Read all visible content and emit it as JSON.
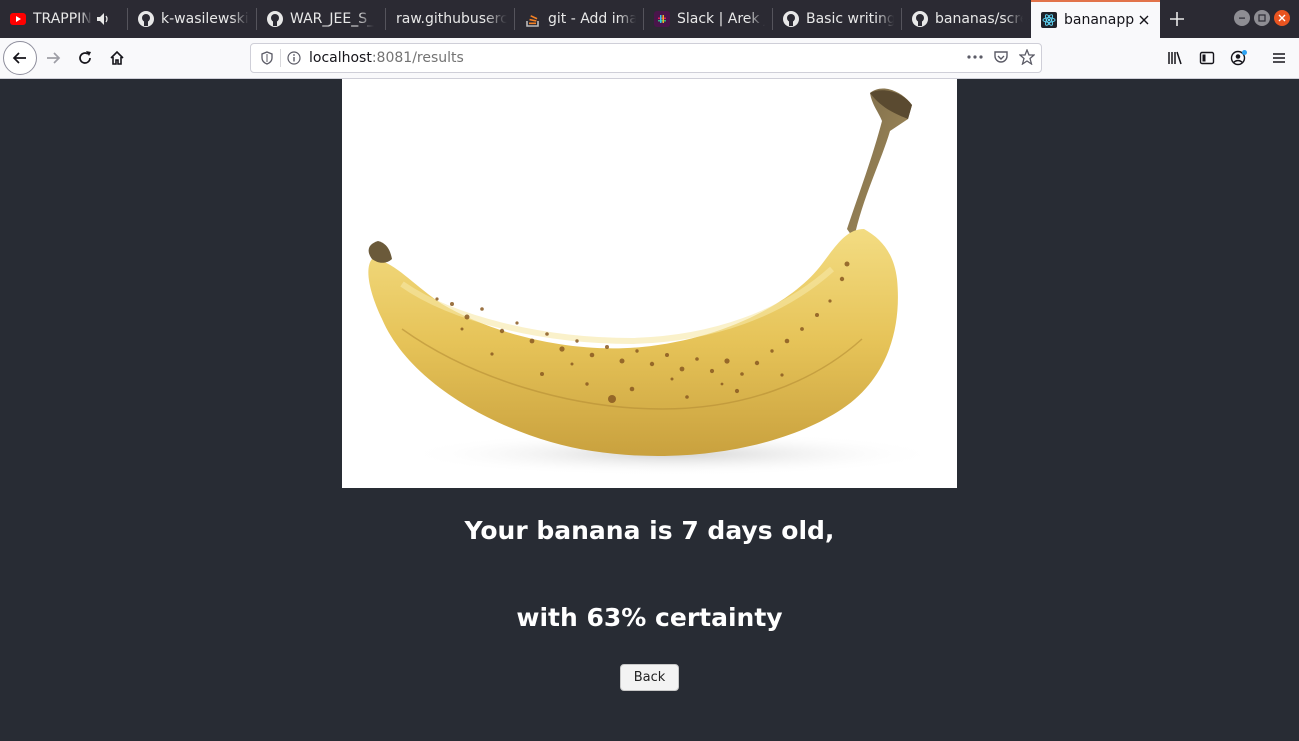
{
  "browser": {
    "tabs": [
      {
        "title": "TRAPPIN",
        "icon": "youtube-icon"
      },
      {
        "title": "k-wasilewski",
        "icon": "github-icon"
      },
      {
        "title": "WAR_JEE_S_",
        "icon": "github-icon"
      },
      {
        "title": "raw.githubuserc",
        "icon": "none"
      },
      {
        "title": "git - Add ima",
        "icon": "stackoverflow-icon"
      },
      {
        "title": "Slack | Arek J",
        "icon": "slack-icon"
      },
      {
        "title": "Basic writing",
        "icon": "github-icon"
      },
      {
        "title": "bananas/scre",
        "icon": "github-icon"
      },
      {
        "title": "bananapp",
        "icon": "react-icon",
        "active": true
      }
    ],
    "url": {
      "host": "localhost",
      "rest": ":8081/results"
    }
  },
  "page": {
    "image_alt": "banana",
    "result_line1": "Your banana is 7 days old,",
    "result_line2": "with 63% certainty",
    "back_label": "Back"
  },
  "colors": {
    "page_bg": "#282c34",
    "text": "#ffffff",
    "active_tab_accent": "#e2734a"
  }
}
